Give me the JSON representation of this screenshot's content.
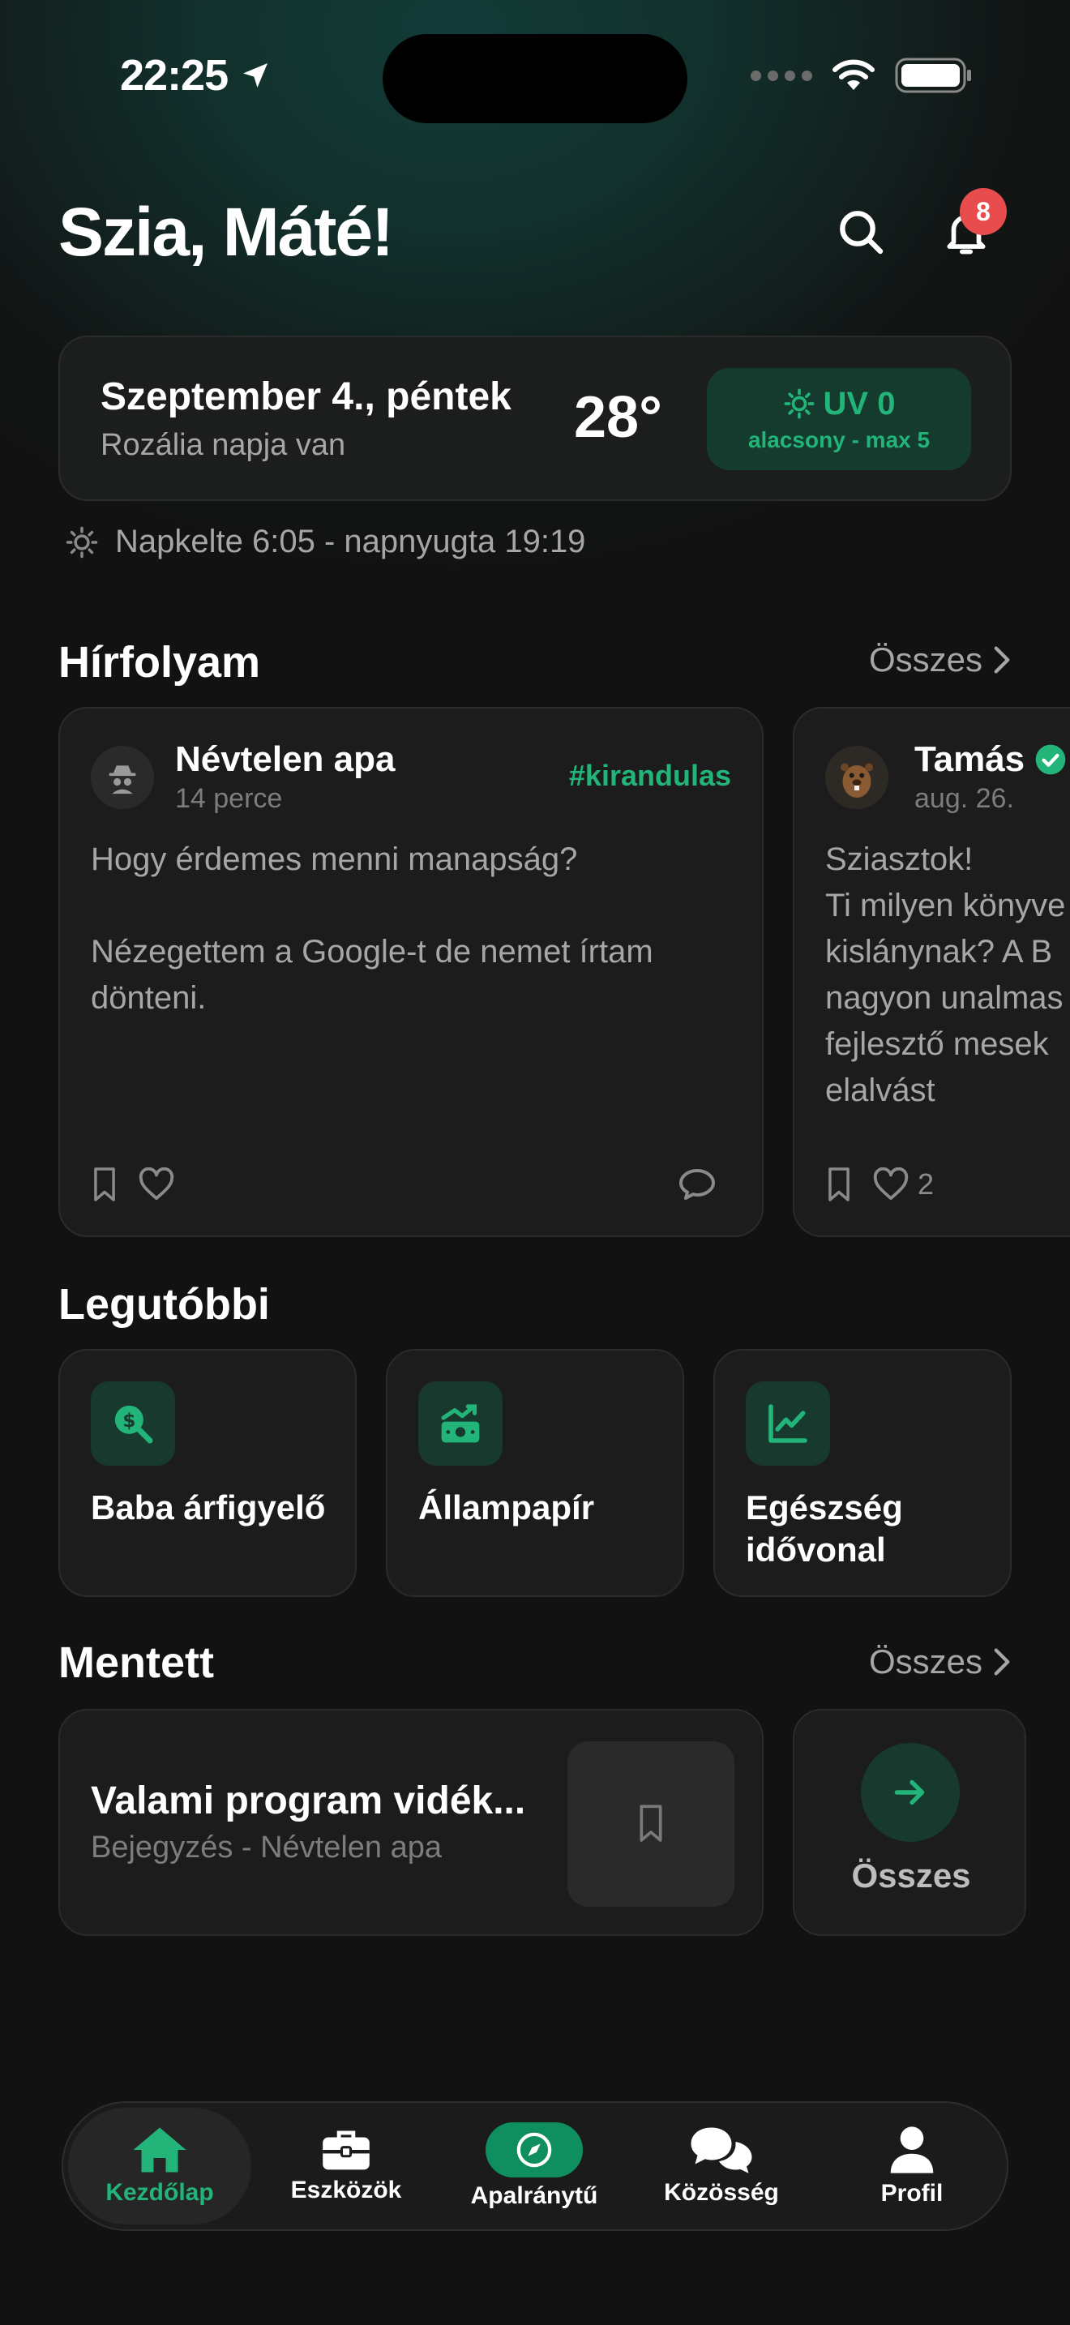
{
  "status_bar": {
    "time": "22:25"
  },
  "header": {
    "greeting": "Szia, Máté!",
    "notification_count": "8"
  },
  "date_card": {
    "date": "Szeptember 4., péntek",
    "nameday": "Rozália napja van",
    "temperature": "28°",
    "uv_title": "UV 0",
    "uv_subtitle": "alacsony - max 5"
  },
  "sun_info": "Napkelte 6:05 - napnyugta 19:19",
  "feed": {
    "title": "Hírfolyam",
    "see_all": "Összes",
    "posts": [
      {
        "author": "Névtelen apa",
        "time": "14 perce",
        "tag": "#kirandulas",
        "body": "Hogy érdemes menni manapság?\n\nNézegettem a Google-t de nemet írtam dönteni.",
        "likes": ""
      },
      {
        "author": "Tamás",
        "time": "aug. 26.",
        "tag": "",
        "body": "Sziasztok!\nTi milyen könyve\nkislánynak? A B\nnagyon unalmas\nfejlesztő mesek\nelalvást",
        "likes": "2"
      }
    ]
  },
  "recent": {
    "title": "Legutóbbi",
    "items": [
      {
        "label": "Baba árfigyelő",
        "icon": "dollar-search-icon"
      },
      {
        "label": "Állampapír",
        "icon": "money-growth-icon"
      },
      {
        "label": "Egészség idővonal",
        "icon": "line-chart-icon"
      }
    ]
  },
  "saved": {
    "title": "Mentett",
    "see_all": "Összes",
    "item_title": "Valami program vidék...",
    "item_sub": "Bejegyzés - Névtelen apa",
    "all_label": "Összes"
  },
  "tabbar": {
    "items": [
      {
        "label": "Kezdőlap",
        "icon": "home-icon"
      },
      {
        "label": "Eszközök",
        "icon": "toolbox-icon"
      },
      {
        "label": "Apalránytű",
        "icon": "compass-icon"
      },
      {
        "label": "Közösség",
        "icon": "chat-bubbles-icon"
      },
      {
        "label": "Profil",
        "icon": "person-icon"
      }
    ]
  },
  "colors": {
    "accent": "#22b478",
    "badge": "#e84c4c",
    "background": "#121212",
    "card": "#1c1c1c"
  }
}
